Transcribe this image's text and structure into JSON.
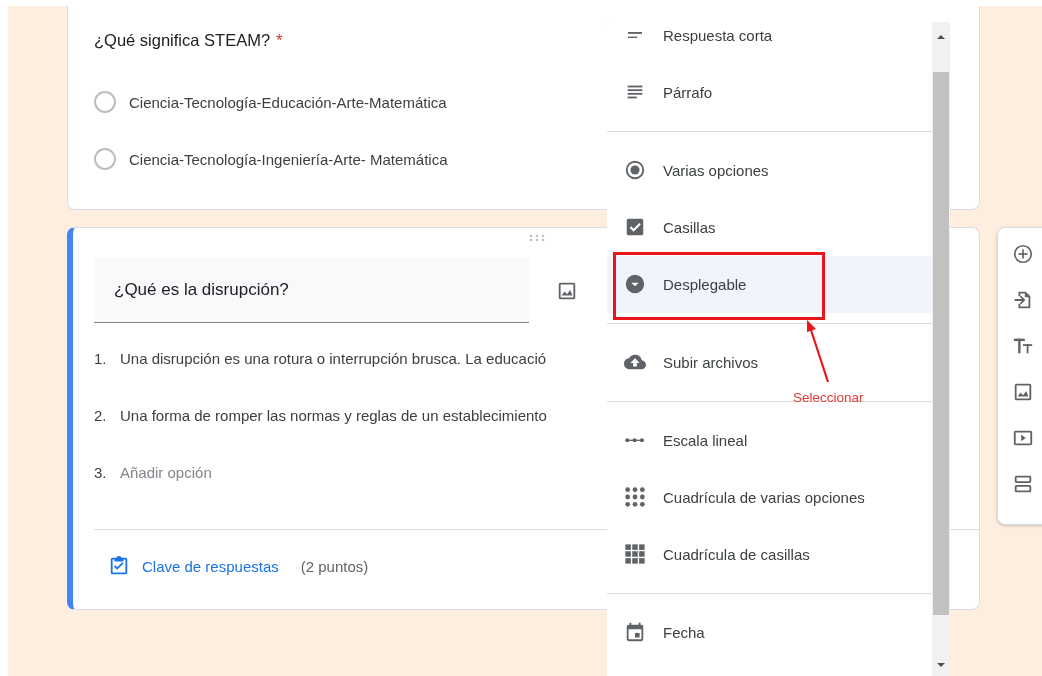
{
  "questions": [
    {
      "kind": "view",
      "title": "¿Qué significa STEAM?",
      "required_mark": "*",
      "options": [
        {
          "label": "Ciencia-Tecnología-Educación-Arte-Matemática",
          "selected": false
        },
        {
          "label": "Ciencia-Tecnología-Ingeniería-Arte- Matemática",
          "selected": false
        }
      ]
    },
    {
      "kind": "edit",
      "title": "¿Qué es la disrupción?",
      "options": [
        {
          "number": "1.",
          "text": "Una disrupción es una rotura o interrupción brusca. La educació"
        },
        {
          "number": "2.",
          "text": "Una forma de romper las normas y reglas de un establecimiento"
        }
      ],
      "add_option": {
        "number": "3.",
        "placeholder": "Añadir opción"
      },
      "answer_key": {
        "label": "Clave de respuestas",
        "points": "(2 puntos)"
      }
    }
  ],
  "type_menu": {
    "sections": [
      {
        "items": [
          {
            "label": "Respuesta corta",
            "kind": "short",
            "selected": false
          },
          {
            "label": "Párrafo",
            "kind": "paragraph",
            "selected": false
          }
        ]
      },
      {
        "items": [
          {
            "label": "Varias opciones",
            "kind": "radio",
            "selected": false
          },
          {
            "label": "Casillas",
            "kind": "checkbox",
            "selected": false
          },
          {
            "label": "Desplegable",
            "kind": "dropdown",
            "selected": true
          }
        ]
      },
      {
        "items": [
          {
            "label": "Subir archivos",
            "kind": "upload",
            "selected": false
          }
        ]
      },
      {
        "items": [
          {
            "label": "Escala lineal",
            "kind": "linear",
            "selected": false
          },
          {
            "label": "Cuadrícula de varias opciones",
            "kind": "grid_radio",
            "selected": false
          },
          {
            "label": "Cuadrícula de casillas",
            "kind": "grid_check",
            "selected": false
          }
        ]
      },
      {
        "items": [
          {
            "label": "Fecha",
            "kind": "date",
            "selected": false
          }
        ]
      }
    ]
  },
  "annotation": {
    "label": "Seleccionar"
  },
  "toolbar": [
    {
      "kind": "add"
    },
    {
      "kind": "import"
    },
    {
      "kind": "title"
    },
    {
      "kind": "image"
    },
    {
      "kind": "video"
    },
    {
      "kind": "section"
    }
  ]
}
